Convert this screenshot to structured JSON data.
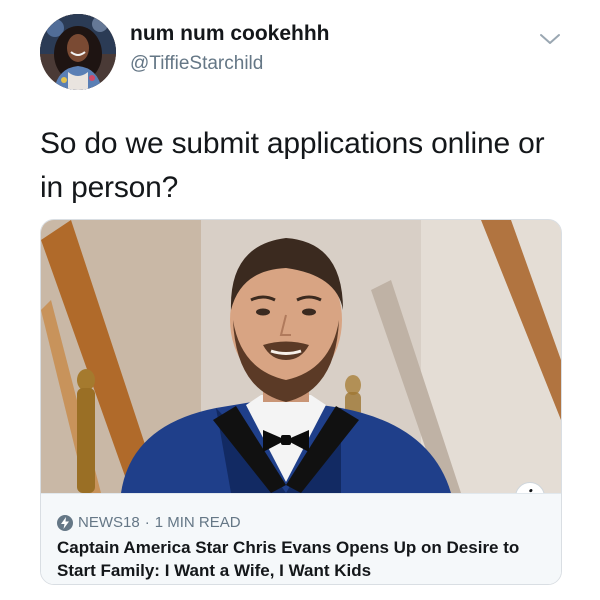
{
  "tweet": {
    "author": {
      "display_name": "num num cookehhh",
      "handle": "@TiffieStarchild",
      "avatar": "profile-photo"
    },
    "text": "So do we submit applications online or in person?",
    "menu_icon": "chevron-down-icon"
  },
  "card": {
    "image": "man-in-tuxedo-photo",
    "info_icon": "info-icon",
    "info_glyph": "i",
    "source_icon": "lightning-bolt-icon",
    "source": "NEWS18",
    "separator": "·",
    "read_time": "1 MIN READ",
    "headline": "Captain America Star Chris Evans Opens Up on Desire to Start Family: I Want a Wife, I Want Kids"
  }
}
